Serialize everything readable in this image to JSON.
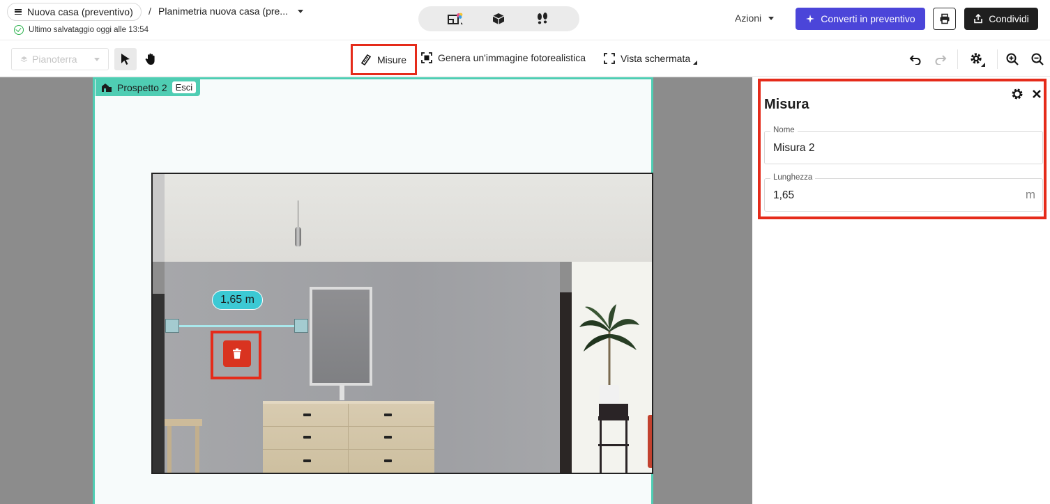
{
  "header": {
    "project_name": "Nuova casa (preventivo)",
    "breadcrumb_separator": "/",
    "plan_name": "Planimetria nuova casa (pre...",
    "save_status": "Ultimo salvataggio oggi alle 13:54",
    "view_modes": [
      "2d-plan-icon",
      "3d-box-icon",
      "walkthrough-footsteps-icon"
    ],
    "actions_label": "Azioni",
    "convert_label": "Converti in preventivo",
    "share_label": "Condividi"
  },
  "toolbar": {
    "floor_select": "Pianoterra",
    "measure_label": "Misure",
    "render_label": "Genera un'immagine fotorealistica",
    "fullscreen_label": "Vista schermata"
  },
  "canvas": {
    "elevation_name": "Prospetto 2",
    "exit_label": "Esci",
    "measurement_label": "1,65 m"
  },
  "panel": {
    "title": "Misura",
    "name_label": "Nome",
    "name_value": "Misura 2",
    "length_label": "Lunghezza",
    "length_value": "1,65",
    "length_unit": "m"
  },
  "colors": {
    "accent_convert": "#4b45d9",
    "highlight_red": "#e52b1a",
    "elevation_teal": "#4fcdb3",
    "measure_cyan": "#3cc9d4",
    "save_green": "#2bb24c"
  }
}
